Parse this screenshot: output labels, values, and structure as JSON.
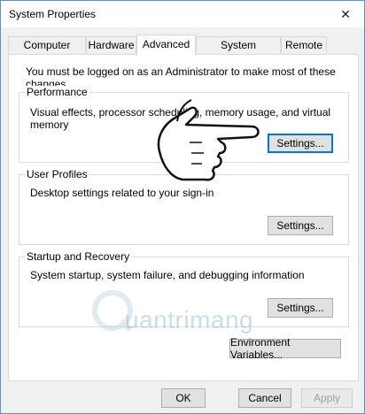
{
  "window": {
    "title": "System Properties",
    "close_glyph": "✕"
  },
  "tabs": [
    {
      "label": "Computer Name"
    },
    {
      "label": "Hardware"
    },
    {
      "label": "Advanced"
    },
    {
      "label": "System Protection"
    },
    {
      "label": "Remote"
    }
  ],
  "active_tab": "Advanced",
  "admin_message": "You must be logged on as an Administrator to make most of these changes.",
  "performance": {
    "title": "Performance",
    "description": "Visual effects, processor scheduling, memory usage, and virtual memory",
    "settings_label": "Settings..."
  },
  "user_profiles": {
    "title": "User Profiles",
    "description": "Desktop settings related to your sign-in",
    "settings_label": "Settings..."
  },
  "startup_recovery": {
    "title": "Startup and Recovery",
    "description": "System startup, system failure, and debugging information",
    "settings_label": "Settings..."
  },
  "env_vars_label": "Environment Variables...",
  "footer": {
    "ok": "OK",
    "cancel": "Cancel",
    "apply": "Apply"
  },
  "watermark_text": "uantrimang",
  "colors": {
    "focus_border": "#0078d7",
    "window_border": "#5b8fd6"
  }
}
